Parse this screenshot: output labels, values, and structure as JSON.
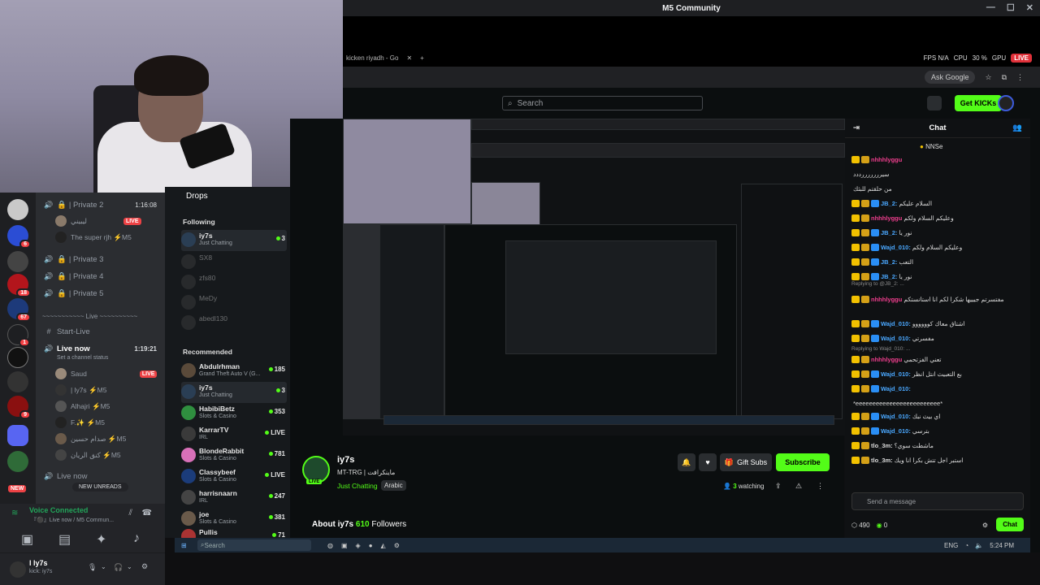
{
  "window": {
    "title": "M5 Community"
  },
  "browser": {
    "tab_title": "kicken riyadh - Go",
    "ask_google": "Ask Google",
    "perf": {
      "fps": "FPS N/A",
      "cpu": "CPU",
      "cpu_val": "30 %",
      "gpu": "GPU",
      "live": "LIVE"
    }
  },
  "kick_header": {
    "search_placeholder": "Search",
    "get_kicks": "Get KICKs"
  },
  "kick_sidebar": {
    "drops": "Drops",
    "following_heading": "Following",
    "following": [
      {
        "name": "iy7s",
        "category": "Just Chatting",
        "count": "3"
      },
      {
        "name": "SX8",
        "category": "",
        "count": ""
      },
      {
        "name": "zfs80",
        "category": "",
        "count": ""
      },
      {
        "name": "MeDy",
        "category": "",
        "count": ""
      },
      {
        "name": "abedl130",
        "category": "",
        "count": ""
      }
    ],
    "recommended_heading": "Recommended",
    "recommended": [
      {
        "name": "Abdulrhman",
        "category": "Grand Theft Auto V (G...",
        "count": "185"
      },
      {
        "name": "iy7s",
        "category": "Just Chatting",
        "count": "3"
      },
      {
        "name": "HabibiBetz",
        "category": "Slots & Casino",
        "count": "353"
      },
      {
        "name": "KarrarTV",
        "category": "IRL",
        "count": "LIVE"
      },
      {
        "name": "BlondeRabbit",
        "category": "Slots & Casino",
        "count": "781"
      },
      {
        "name": "Classybeef",
        "category": "Slots & Casino",
        "count": "LIVE"
      },
      {
        "name": "harrisnaarn",
        "category": "IRL",
        "count": "247"
      },
      {
        "name": "joe",
        "category": "Slots & Casino",
        "count": "381"
      },
      {
        "name": "Pullis",
        "category": "Just Chatting",
        "count": "71"
      }
    ]
  },
  "discord": {
    "channels": [
      {
        "label": "| Private 2",
        "time": "1:16:08"
      },
      {
        "label": "| Private 3",
        "time": ""
      },
      {
        "label": "| Private 4",
        "time": ""
      },
      {
        "label": "| Private 5",
        "time": ""
      }
    ],
    "private2_users": [
      "ليبيني",
      "The super rjh ⚡M5"
    ],
    "live_label": "LIVE",
    "section_live": "~~~~~~~~~~~ Live ~~~~~~~~~~",
    "start_live": "Start-Live",
    "live_now": {
      "label": "Live now",
      "time": "1:19:21",
      "status": "Set a channel status"
    },
    "live_now_users": [
      "Saud",
      "| ly7s ⚡M5",
      "Alhajri ⚡M5",
      "F.✨ ⚡M5",
      "صدام حسين ⚡M5",
      "كنق الريان ⚡M5"
    ],
    "live_now_2": "Live now",
    "new_unreads": "NEW UNREADS",
    "voice": {
      "status": "Voice Connected",
      "channel": "『⚫』Live now / M5 Commun..."
    },
    "user": {
      "name": "l ly7s",
      "sub": "kick: iy7s"
    },
    "server_badges": [
      "6",
      "18",
      "67",
      "1",
      "9"
    ],
    "new_badge": "NEW"
  },
  "stream": {
    "channel_name": "iy7s",
    "live": "LIVE",
    "title": "MT-TRG | ماينكرافت",
    "category": "Just Chatting",
    "tag": "Arabic",
    "gift_subs": "Gift Subs",
    "subscribe": "Subscribe",
    "watching_count": "3",
    "watching_label": "watching",
    "about_label": "About iy7s",
    "followers": "610",
    "followers_label": "Followers"
  },
  "chat": {
    "title": "Chat",
    "pinned": "NNSe",
    "messages": [
      {
        "user": "nhhhlyggu",
        "text": "",
        "color": "pink"
      },
      {
        "user": "",
        "text": "سيرررررررددد",
        "color": ""
      },
      {
        "user": "",
        "text": "من حلقتم للبثك",
        "color": ""
      },
      {
        "user": "JB_2:",
        "text": "السلام عليكم",
        "color": "blue"
      },
      {
        "user": "nhhhlyggu",
        "text": "وعليكم السلام ولكم",
        "color": "pink"
      },
      {
        "user": "JB_2:",
        "text": "نور يا",
        "color": "blue"
      },
      {
        "user": "Wajd_010:",
        "text": "وعليكم السلام ولكم",
        "color": "blue"
      },
      {
        "user": "JB_2:",
        "text": "التعب",
        "color": "blue"
      },
      {
        "user": "JB_2:",
        "text": "نور يا",
        "color": "blue"
      },
      {
        "user": "nhhhlyggu",
        "text": "مفتسرتم جيييها شكرا لكم انا استانستكم",
        "color": "pink"
      },
      {
        "user": "Wajd_010:",
        "text": "اشتاق معاك كوووووو",
        "color": "blue"
      },
      {
        "user": "Wajd_010:",
        "text": "مفسرتي",
        "color": "blue"
      },
      {
        "user": "nhhhlyggu",
        "text": "تعني الفزتحمي",
        "color": "pink"
      },
      {
        "user": "Wajd_010:",
        "text": "بع التعبيث انتل انظر",
        "color": "blue"
      },
      {
        "user": "Wajd_010:",
        "text": "",
        "color": "blue"
      },
      {
        "user": "",
        "text": "*eeeeeeeeeeeeeeeeeeeeeeeee*",
        "color": ""
      },
      {
        "user": "Wajd_010:",
        "text": "اي بيث نبك",
        "color": "blue"
      },
      {
        "user": "Wajd_010:",
        "text": "بترسي",
        "color": "blue"
      },
      {
        "user": "tlo_3m:",
        "text": "ماشطت سوي؟",
        "color": ""
      },
      {
        "user": "tlo_3m:",
        "text": "استبر اجل تتش بكرا انا ويك",
        "color": ""
      }
    ],
    "reply1": "Replying to @JB_2: ...",
    "reply2": "Replying to Wajd_010: ...",
    "input_placeholder": "Send a message",
    "points": "490",
    "points2": "0",
    "chat_button": "Chat"
  },
  "taskbar": {
    "search": "Search",
    "lang": "ENG",
    "time": "5:24 PM"
  },
  "colors": {
    "kick_green": "#53fc18",
    "discord_bg": "#2b2d31",
    "live_red": "#ed4245"
  },
  "icons": [
    "search-icon",
    "gear-icon",
    "bell-icon",
    "heart-icon",
    "share-icon",
    "mic-icon",
    "headphones-icon",
    "speaker-icon",
    "hash-icon",
    "lock-icon",
    "chevron-down-icon"
  ]
}
